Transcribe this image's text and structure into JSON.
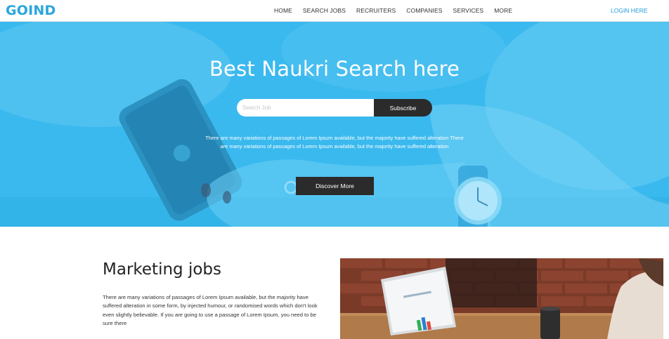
{
  "navbar": {
    "logo": "GOIND",
    "links": [
      "HOME",
      "SEARCH JOBS",
      "RECRUITERS",
      "COMPANIES",
      "SERVICES",
      "MORE"
    ],
    "login": "LOGIN HERE"
  },
  "hero": {
    "title": "Best Naukri Search here",
    "search_placeholder": "Search Job",
    "subscribe_label": "Subscribe",
    "description": "There are many variations of passages of Lorem Ipsum available, but the majority have suffered alteration There are many variations of passages of Lorem Ipsum available, but the majority have suffered alteration",
    "discover_label": "Discover More",
    "overlay_color": "#3bbdf0"
  },
  "section": {
    "title": "Marketing jobs",
    "text": "There are many variations of passages of Lorem Ipsum available, but the majority have suffered alteration in some form, by injected humour, or randomised words which don't look even slightly believable. If you are going to use a passage of Lorem Ipsum, you need to be sure there"
  }
}
